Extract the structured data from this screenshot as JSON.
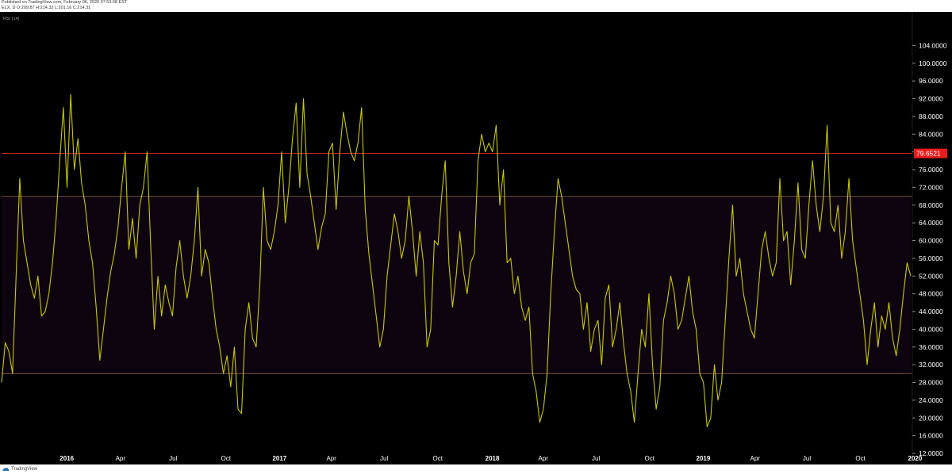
{
  "header": {
    "published": "Published on TradingView.com, February 06, 2020 07:53:08 EST",
    "symbol_line": "ELX, D  O:209.87 H:214.33 L:201.16 C:214.31"
  },
  "footer": {
    "brand": "TradingView"
  },
  "colors": {
    "background": "#000000",
    "band_fill": "#0e0410",
    "rsi_line": "#c8c800",
    "band_line": "#6e4f3a",
    "overbought_line": "#d22c2c",
    "price_badge": "#e81c1c",
    "axis_text": "#ffffff"
  },
  "chart_data": {
    "type": "line",
    "indicator_label": "RSI (14)",
    "ylim": [
      12,
      108
    ],
    "y_ticks": [
      "104.0000",
      "100.0000",
      "96.0000",
      "92.0000",
      "88.0000",
      "84.0000",
      "80.0000",
      "76.0000",
      "72.0000",
      "68.0000",
      "64.0000",
      "60.0000",
      "56.0000",
      "52.0000",
      "48.0000",
      "44.0000",
      "40.0000",
      "36.0000",
      "32.0000",
      "28.0000",
      "24.0000",
      "20.0000",
      "16.0000",
      "12.0000"
    ],
    "y_tick_values": [
      104,
      100,
      96,
      92,
      88,
      84,
      80,
      76,
      72,
      68,
      64,
      60,
      56,
      52,
      48,
      44,
      40,
      36,
      32,
      28,
      24,
      20,
      16,
      12
    ],
    "x_ticks": [
      {
        "label": "2016",
        "bold": true,
        "t": 0.063
      },
      {
        "label": "Apr",
        "bold": false,
        "t": 0.122
      },
      {
        "label": "Jul",
        "bold": false,
        "t": 0.18
      },
      {
        "label": "Oct",
        "bold": false,
        "t": 0.238
      },
      {
        "label": "2017",
        "bold": true,
        "t": 0.297
      },
      {
        "label": "Apr",
        "bold": false,
        "t": 0.354
      },
      {
        "label": "Jul",
        "bold": false,
        "t": 0.412
      },
      {
        "label": "Oct",
        "bold": false,
        "t": 0.471
      },
      {
        "label": "2018",
        "bold": true,
        "t": 0.531
      },
      {
        "label": "Apr",
        "bold": false,
        "t": 0.587
      },
      {
        "label": "Jul",
        "bold": false,
        "t": 0.645
      },
      {
        "label": "Oct",
        "bold": false,
        "t": 0.704
      },
      {
        "label": "2019",
        "bold": true,
        "t": 0.763
      },
      {
        "label": "Apr",
        "bold": false,
        "t": 0.82
      },
      {
        "label": "Jul",
        "bold": false,
        "t": 0.877
      },
      {
        "label": "Oct",
        "bold": false,
        "t": 0.936
      },
      {
        "label": "2020",
        "bold": true,
        "t": 0.996
      }
    ],
    "band_upper": 70,
    "band_lower": 30,
    "overbought_level": 79.6521,
    "last_value_label": "79.6521",
    "series": [
      {
        "points": [
          [
            0.0,
            28
          ],
          [
            0.004,
            37
          ],
          [
            0.008,
            35
          ],
          [
            0.012,
            30
          ],
          [
            0.016,
            52
          ],
          [
            0.02,
            74
          ],
          [
            0.024,
            60
          ],
          [
            0.028,
            55
          ],
          [
            0.032,
            50
          ],
          [
            0.036,
            47
          ],
          [
            0.04,
            52
          ],
          [
            0.044,
            43
          ],
          [
            0.048,
            44
          ],
          [
            0.052,
            48
          ],
          [
            0.056,
            55
          ],
          [
            0.06,
            65
          ],
          [
            0.064,
            78
          ],
          [
            0.068,
            90
          ],
          [
            0.072,
            72
          ],
          [
            0.076,
            93
          ],
          [
            0.08,
            76
          ],
          [
            0.084,
            83
          ],
          [
            0.088,
            73
          ],
          [
            0.092,
            68
          ],
          [
            0.096,
            60
          ],
          [
            0.1,
            55
          ],
          [
            0.104,
            45
          ],
          [
            0.108,
            33
          ],
          [
            0.112,
            40
          ],
          [
            0.116,
            47
          ],
          [
            0.12,
            53
          ],
          [
            0.124,
            57
          ],
          [
            0.128,
            63
          ],
          [
            0.132,
            72
          ],
          [
            0.136,
            80
          ],
          [
            0.14,
            58
          ],
          [
            0.144,
            65
          ],
          [
            0.148,
            56
          ],
          [
            0.152,
            68
          ],
          [
            0.156,
            72
          ],
          [
            0.16,
            80
          ],
          [
            0.164,
            59
          ],
          [
            0.168,
            40
          ],
          [
            0.172,
            52
          ],
          [
            0.176,
            43
          ],
          [
            0.18,
            50
          ],
          [
            0.184,
            46
          ],
          [
            0.188,
            43
          ],
          [
            0.192,
            54
          ],
          [
            0.196,
            60
          ],
          [
            0.2,
            52
          ],
          [
            0.204,
            47
          ],
          [
            0.208,
            52
          ],
          [
            0.212,
            60
          ],
          [
            0.216,
            72
          ],
          [
            0.22,
            52
          ],
          [
            0.224,
            58
          ],
          [
            0.228,
            55
          ],
          [
            0.232,
            47
          ],
          [
            0.236,
            40
          ],
          [
            0.24,
            36
          ],
          [
            0.244,
            30
          ],
          [
            0.248,
            34
          ],
          [
            0.252,
            27
          ],
          [
            0.256,
            36
          ],
          [
            0.26,
            22
          ],
          [
            0.264,
            21
          ],
          [
            0.268,
            40
          ],
          [
            0.272,
            46
          ],
          [
            0.276,
            38
          ],
          [
            0.28,
            36
          ],
          [
            0.284,
            50
          ],
          [
            0.288,
            72
          ],
          [
            0.292,
            60
          ],
          [
            0.296,
            58
          ],
          [
            0.3,
            62
          ],
          [
            0.304,
            68
          ],
          [
            0.308,
            80
          ],
          [
            0.312,
            64
          ],
          [
            0.316,
            72
          ],
          [
            0.32,
            83
          ],
          [
            0.324,
            91
          ],
          [
            0.328,
            72
          ],
          [
            0.332,
            92
          ],
          [
            0.336,
            75
          ],
          [
            0.34,
            70
          ],
          [
            0.344,
            64
          ],
          [
            0.348,
            58
          ],
          [
            0.352,
            63
          ],
          [
            0.356,
            66
          ],
          [
            0.36,
            80
          ],
          [
            0.364,
            82
          ],
          [
            0.368,
            67
          ],
          [
            0.372,
            80
          ],
          [
            0.376,
            89
          ],
          [
            0.38,
            84
          ],
          [
            0.384,
            80
          ],
          [
            0.388,
            78
          ],
          [
            0.392,
            82
          ],
          [
            0.396,
            90
          ],
          [
            0.4,
            67
          ],
          [
            0.404,
            57
          ],
          [
            0.408,
            50
          ],
          [
            0.412,
            43
          ],
          [
            0.416,
            36
          ],
          [
            0.42,
            40
          ],
          [
            0.424,
            52
          ],
          [
            0.428,
            59
          ],
          [
            0.432,
            66
          ],
          [
            0.436,
            62
          ],
          [
            0.44,
            56
          ],
          [
            0.444,
            60
          ],
          [
            0.448,
            70
          ],
          [
            0.452,
            62
          ],
          [
            0.456,
            52
          ],
          [
            0.46,
            62
          ],
          [
            0.464,
            55
          ],
          [
            0.468,
            36
          ],
          [
            0.472,
            40
          ],
          [
            0.476,
            60
          ],
          [
            0.48,
            59
          ],
          [
            0.484,
            70
          ],
          [
            0.488,
            78
          ],
          [
            0.492,
            55
          ],
          [
            0.496,
            45
          ],
          [
            0.5,
            52
          ],
          [
            0.504,
            62
          ],
          [
            0.508,
            53
          ],
          [
            0.512,
            48
          ],
          [
            0.516,
            55
          ],
          [
            0.52,
            57
          ],
          [
            0.524,
            78
          ],
          [
            0.528,
            84
          ],
          [
            0.532,
            80
          ],
          [
            0.536,
            82
          ],
          [
            0.54,
            80
          ],
          [
            0.544,
            86
          ],
          [
            0.548,
            68
          ],
          [
            0.552,
            76
          ],
          [
            0.556,
            55
          ],
          [
            0.56,
            56
          ],
          [
            0.564,
            48
          ],
          [
            0.568,
            52
          ],
          [
            0.572,
            45
          ],
          [
            0.576,
            42
          ],
          [
            0.58,
            45
          ],
          [
            0.584,
            30
          ],
          [
            0.588,
            26
          ],
          [
            0.592,
            19
          ],
          [
            0.596,
            22
          ],
          [
            0.6,
            30
          ],
          [
            0.604,
            48
          ],
          [
            0.608,
            62
          ],
          [
            0.612,
            74
          ],
          [
            0.616,
            70
          ],
          [
            0.62,
            64
          ],
          [
            0.624,
            58
          ],
          [
            0.628,
            52
          ],
          [
            0.632,
            49
          ],
          [
            0.636,
            48
          ],
          [
            0.64,
            40
          ],
          [
            0.644,
            46
          ],
          [
            0.648,
            35
          ],
          [
            0.652,
            40
          ],
          [
            0.656,
            42
          ],
          [
            0.66,
            32
          ],
          [
            0.664,
            47
          ],
          [
            0.668,
            50
          ],
          [
            0.672,
            36
          ],
          [
            0.676,
            40
          ],
          [
            0.68,
            46
          ],
          [
            0.684,
            37
          ],
          [
            0.688,
            30
          ],
          [
            0.692,
            26
          ],
          [
            0.696,
            19
          ],
          [
            0.7,
            30
          ],
          [
            0.704,
            40
          ],
          [
            0.708,
            36
          ],
          [
            0.712,
            48
          ],
          [
            0.716,
            32
          ],
          [
            0.72,
            22
          ],
          [
            0.724,
            27
          ],
          [
            0.728,
            42
          ],
          [
            0.732,
            46
          ],
          [
            0.736,
            52
          ],
          [
            0.74,
            48
          ],
          [
            0.744,
            40
          ],
          [
            0.748,
            42
          ],
          [
            0.752,
            47
          ],
          [
            0.756,
            52
          ],
          [
            0.76,
            44
          ],
          [
            0.764,
            40
          ],
          [
            0.768,
            30
          ],
          [
            0.772,
            28
          ],
          [
            0.776,
            18
          ],
          [
            0.78,
            20
          ],
          [
            0.784,
            32
          ],
          [
            0.788,
            24
          ],
          [
            0.792,
            28
          ],
          [
            0.796,
            42
          ],
          [
            0.8,
            56
          ],
          [
            0.804,
            68
          ],
          [
            0.808,
            52
          ],
          [
            0.812,
            56
          ],
          [
            0.816,
            48
          ],
          [
            0.82,
            44
          ],
          [
            0.824,
            40
          ],
          [
            0.828,
            38
          ],
          [
            0.832,
            48
          ],
          [
            0.836,
            58
          ],
          [
            0.84,
            62
          ],
          [
            0.844,
            56
          ],
          [
            0.848,
            52
          ],
          [
            0.852,
            55
          ],
          [
            0.856,
            74
          ],
          [
            0.86,
            60
          ],
          [
            0.864,
            62
          ],
          [
            0.868,
            50
          ],
          [
            0.872,
            60
          ],
          [
            0.876,
            73
          ],
          [
            0.88,
            58
          ],
          [
            0.884,
            56
          ],
          [
            0.888,
            68
          ],
          [
            0.892,
            78
          ],
          [
            0.896,
            68
          ],
          [
            0.9,
            62
          ],
          [
            0.904,
            70
          ],
          [
            0.908,
            86
          ],
          [
            0.912,
            64
          ],
          [
            0.916,
            62
          ],
          [
            0.92,
            68
          ],
          [
            0.924,
            56
          ],
          [
            0.928,
            62
          ],
          [
            0.932,
            74
          ],
          [
            0.936,
            60
          ],
          [
            0.94,
            54
          ],
          [
            0.944,
            48
          ],
          [
            0.948,
            42
          ],
          [
            0.952,
            32
          ],
          [
            0.956,
            40
          ],
          [
            0.96,
            46
          ],
          [
            0.964,
            36
          ],
          [
            0.968,
            43
          ],
          [
            0.972,
            40
          ],
          [
            0.976,
            46
          ],
          [
            0.98,
            38
          ],
          [
            0.984,
            34
          ],
          [
            0.988,
            40
          ],
          [
            0.992,
            48
          ],
          [
            0.996,
            55
          ],
          [
            1.0,
            52
          ]
        ]
      }
    ]
  }
}
